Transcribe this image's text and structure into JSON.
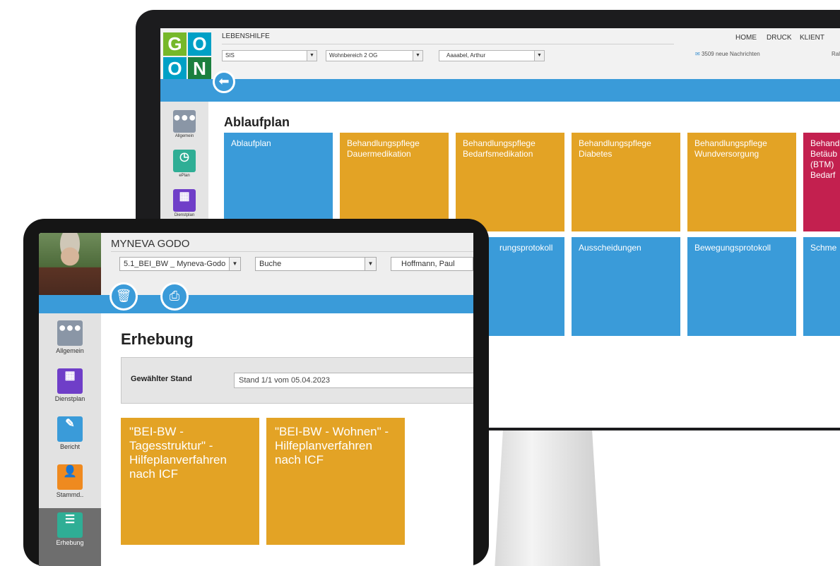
{
  "monitor": {
    "logo_letters": [
      "G",
      "O",
      "O",
      "N"
    ],
    "org_name": "LEBENSHILFE",
    "selects": [
      {
        "value": "SIS"
      },
      {
        "value": "Wohnbereich 2 OG"
      },
      {
        "value": "Aaaabel, Arthur"
      }
    ],
    "nav": [
      "HOME",
      "DRUCK",
      "KLIENT"
    ],
    "messages": "3509 neue Nachrichten",
    "user": "Ralph Z",
    "sidebar": [
      {
        "label": "Allgemein"
      },
      {
        "label": "ePlan"
      },
      {
        "label": "Dienstplan"
      }
    ],
    "page_title": "Ablaufplan",
    "tiles_row1": [
      {
        "label": "Ablaufplan",
        "color": "#3a9bd9"
      },
      {
        "label": "Behandlungspflege Dauermedikation",
        "color": "#e3a325"
      },
      {
        "label": "Behandlungspflege Bedarfsmedikation",
        "color": "#e3a325"
      },
      {
        "label": "Behandlungspflege Diabetes",
        "color": "#e3a325"
      },
      {
        "label": "Behandlungspflege Wundversorgung",
        "color": "#e3a325"
      },
      {
        "label": "Behand Betäub (BTM) Bedarf",
        "color": "#c3204f"
      }
    ],
    "tiles_row2": [
      {
        "label": "rungsprotokoll",
        "color": "#3a9bd9"
      },
      {
        "label": "Ausscheidungen",
        "color": "#3a9bd9"
      },
      {
        "label": "Bewegungsprotokoll",
        "color": "#3a9bd9"
      },
      {
        "label": "Schme",
        "color": "#3a9bd9"
      }
    ]
  },
  "tablet": {
    "org_name": "MYNEVA GODO",
    "selects": [
      {
        "value": "5.1_BEI_BW _ Myneva-Godo"
      },
      {
        "value": "Buche"
      },
      {
        "value": "Hoffmann, Paul"
      }
    ],
    "sidebar": [
      {
        "label": "Allgemein"
      },
      {
        "label": "Dienstplan"
      },
      {
        "label": "Bericht"
      },
      {
        "label": "Stammd.."
      },
      {
        "label": "Erhebung"
      }
    ],
    "page_title": "Erhebung",
    "stand_label": "Gewählter Stand",
    "stand_value": "Stand 1/1 vom 05.04.2023",
    "tiles": [
      {
        "label": "\"BEI-BW - Tagesstruktur\" - Hilfeplanverfahren nach ICF"
      },
      {
        "label": "\"BEI-BW - Wohnen\" - Hilfeplanverfahren nach ICF"
      }
    ]
  },
  "colors": {
    "accent_blue": "#3a9bd9",
    "tile_gold": "#e3a325",
    "tile_red": "#c3204f"
  }
}
